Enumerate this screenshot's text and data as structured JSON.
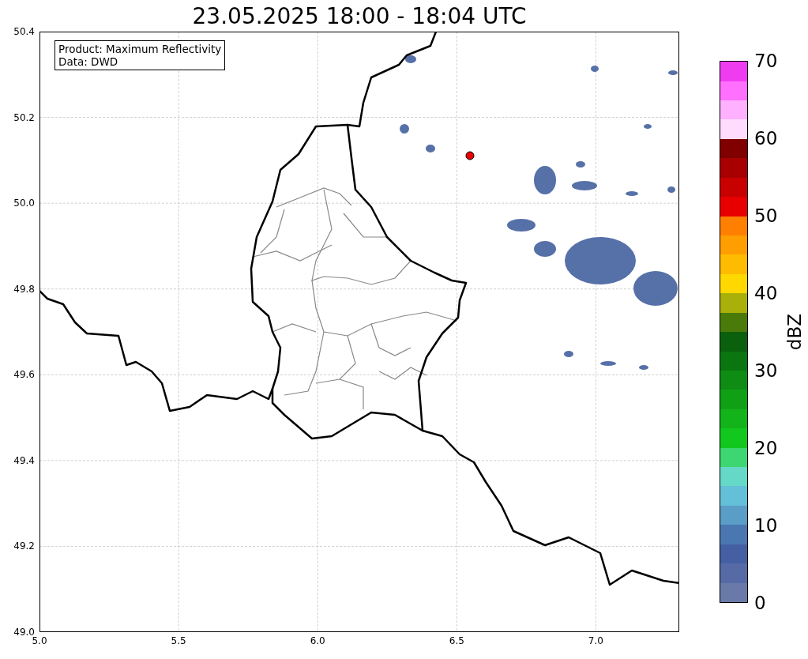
{
  "title": "23.05.2025 18:00 - 18:04 UTC",
  "map": {
    "info_box": [
      "Product: Maximum Reflectivity",
      "Data: DWD"
    ],
    "x_ticks": [
      "5.0",
      "5.5",
      "6.0",
      "6.5",
      "7.0"
    ],
    "y_ticks": [
      "50.4",
      "50.2",
      "50.0",
      "49.8",
      "49.6",
      "49.4",
      "49.2",
      "49.0"
    ]
  },
  "colorbar": {
    "label": "dBZ",
    "ticks": [
      "70",
      "60",
      "50",
      "40",
      "30",
      "20",
      "10",
      "0"
    ],
    "bins": [
      {
        "color": "#6a7aa8"
      },
      {
        "color": "#566aa6"
      },
      {
        "color": "#4560a2"
      },
      {
        "color": "#4a77b0"
      },
      {
        "color": "#5a9dc6"
      },
      {
        "color": "#63c0d8"
      },
      {
        "color": "#66d8c8"
      },
      {
        "color": "#3dd672"
      },
      {
        "color": "#12c81e"
      },
      {
        "color": "#12b41a"
      },
      {
        "color": "#10a016"
      },
      {
        "color": "#0e8c14"
      },
      {
        "color": "#0b7510"
      },
      {
        "color": "#0a600c"
      },
      {
        "color": "#4a7a0a"
      },
      {
        "color": "#aab00a"
      },
      {
        "color": "#ffd800"
      },
      {
        "color": "#ffbb00"
      },
      {
        "color": "#ff9e00"
      },
      {
        "color": "#ff8000"
      },
      {
        "color": "#e80000"
      },
      {
        "color": "#c80000"
      },
      {
        "color": "#a80000"
      },
      {
        "color": "#800000"
      },
      {
        "color": "#ffdcff"
      },
      {
        "color": "#ffb0ff"
      },
      {
        "color": "#ff70ff"
      },
      {
        "color": "#f03cf0"
      }
    ]
  }
}
